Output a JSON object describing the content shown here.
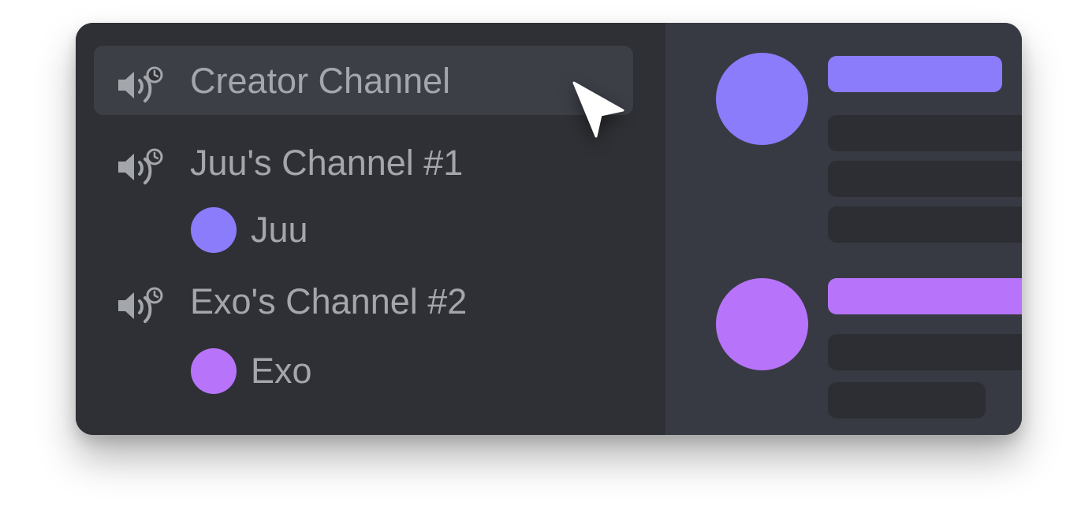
{
  "channels": [
    {
      "label": "Creator Channel",
      "icon": "voice-channel-clock-icon",
      "active": true
    },
    {
      "label": "Juu's Channel #1",
      "icon": "voice-channel-clock-icon",
      "active": false
    },
    {
      "label": "Exo's Channel #2",
      "icon": "voice-channel-clock-icon",
      "active": false
    }
  ],
  "users": [
    {
      "name": "Juu",
      "color": "#8b7cfb"
    },
    {
      "name": "Exo",
      "color": "#b774fb"
    }
  ],
  "colors": {
    "card_background": "#2f3035",
    "main_background": "#383a43",
    "active_row": "#3d3f47",
    "text": "#a3a6ab",
    "placeholder": "#2d2e33",
    "accent_juu": "#8b7cfb",
    "accent_exo": "#b774fb"
  },
  "cursor": {
    "icon": "mouse-pointer-icon"
  }
}
